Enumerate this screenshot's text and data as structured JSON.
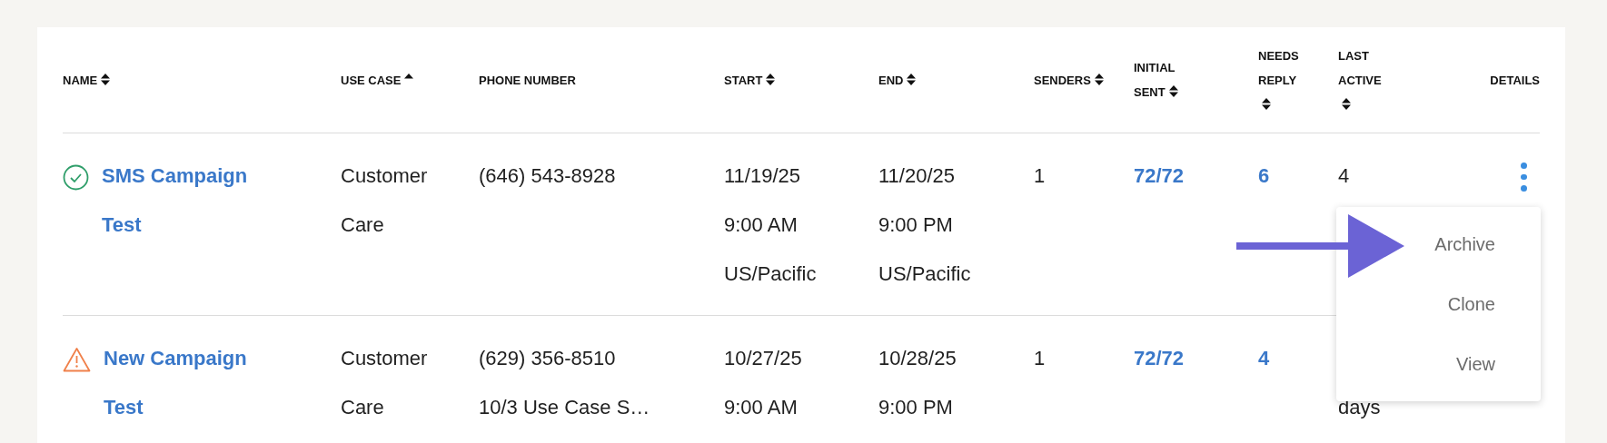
{
  "table": {
    "columns": [
      {
        "label": "NAME",
        "sortable": true,
        "sorted": false
      },
      {
        "label": "USE CASE",
        "sortable": true,
        "sorted": true
      },
      {
        "label": "PHONE NUMBER",
        "sortable": false,
        "sorted": false
      },
      {
        "label": "START",
        "sortable": true,
        "sorted": false
      },
      {
        "label": "END",
        "sortable": true,
        "sorted": false
      },
      {
        "label": "SENDERS",
        "sortable": true,
        "sorted": false
      },
      {
        "label": "INITIAL SENT",
        "sortable": true,
        "sorted": false
      },
      {
        "label": "NEEDS REPLY",
        "sortable": true,
        "sorted": false
      },
      {
        "label": "LAST ACTIVE",
        "sortable": true,
        "sorted": false
      },
      {
        "label": "DETAILS",
        "sortable": false,
        "sorted": false
      }
    ],
    "rows": [
      {
        "kind": "ok",
        "name": "SMS Campaign Test",
        "use_case": "Customer Care",
        "phone": [
          "(646) 543-8928"
        ],
        "start": [
          "11/19/25",
          "9:00 AM",
          "US/Pacific"
        ],
        "end": [
          "11/20/25",
          "9:00 PM",
          "US/Pacific"
        ],
        "senders": "1",
        "initial_sent": "72/72",
        "needs_reply": "6",
        "last_active": [
          "4"
        ],
        "menu": [
          "Archive",
          "Clone",
          "View"
        ]
      },
      {
        "kind": "warning",
        "name": "New Campaign Test",
        "use_case": "Customer Care",
        "phone": [
          "(629) 356-8510",
          "10/3 Use Case S…"
        ],
        "start": [
          "10/27/25",
          "9:00 AM"
        ],
        "end": [
          "10/28/25",
          "9:00 PM"
        ],
        "senders": "1",
        "initial_sent": "72/72",
        "needs_reply": "4",
        "last_active": [
          "days"
        ]
      }
    ]
  },
  "annotation": {
    "kind": "arrow"
  }
}
